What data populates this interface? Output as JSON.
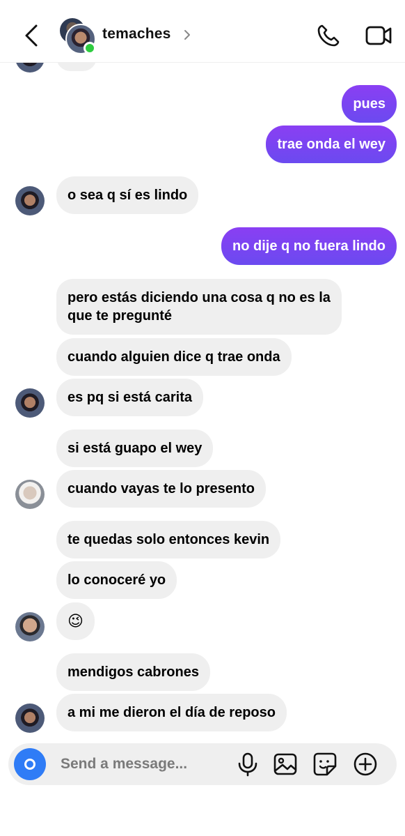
{
  "header": {
    "contact_name": "temaches"
  },
  "messages": [
    {
      "side": "in",
      "text": ""
    },
    {
      "side": "out",
      "text": "pues"
    },
    {
      "side": "out",
      "text": "trae onda el wey"
    },
    {
      "side": "in",
      "text": "o sea q sí es lindo"
    },
    {
      "side": "out",
      "text": "no dije q no fuera lindo"
    },
    {
      "side": "in",
      "text": "pero estás diciendo una cosa q no es la que te pregunté"
    },
    {
      "side": "in",
      "text": "cuando alguien dice q trae onda"
    },
    {
      "side": "in",
      "text": "es pq si está carita"
    },
    {
      "side": "in",
      "text": "si está guapo el wey"
    },
    {
      "side": "in",
      "text": "cuando vayas te lo presento"
    },
    {
      "side": "in",
      "text": "te quedas solo entonces kevin"
    },
    {
      "side": "in",
      "text": "lo conoceré yo"
    },
    {
      "side": "in",
      "text": "😉"
    },
    {
      "side": "in",
      "text": "mendigos cabrones"
    },
    {
      "side": "in",
      "text": "a mi me dieron el día de reposo"
    }
  ],
  "composer": {
    "placeholder": "Send a message..."
  },
  "icons": {
    "back": "chevron-left-icon",
    "call": "phone-icon",
    "video": "video-camera-icon",
    "camera": "camera-icon",
    "mic": "microphone-icon",
    "gallery": "image-icon",
    "sticker": "sticker-icon",
    "more": "plus-circle-icon"
  },
  "colors": {
    "outgoing_bubble": "#7b40f2",
    "incoming_bubble": "#efefef",
    "camera_button": "#2f7cf6",
    "online_dot": "#2ecc40"
  }
}
